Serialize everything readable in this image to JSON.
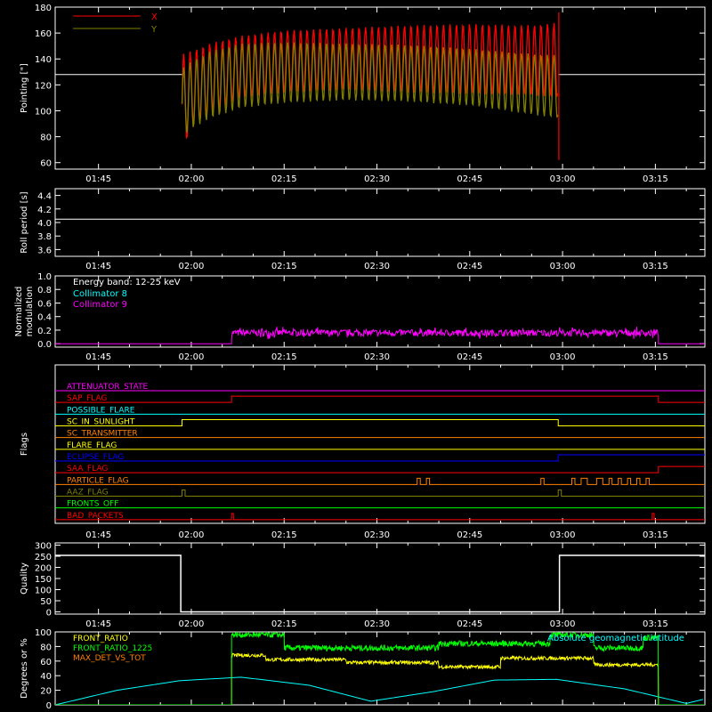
{
  "time_axis": {
    "tick_labels": [
      "01:45",
      "02:00",
      "02:15",
      "02:30",
      "02:45",
      "03:00",
      "03:15"
    ],
    "tick_minutes": [
      105,
      120,
      135,
      150,
      165,
      180,
      195
    ],
    "range_minutes": [
      98,
      203
    ]
  },
  "chart_data": [
    {
      "id": "pointing",
      "type": "line",
      "ylabel": "Pointing [\"]",
      "ylim": [
        55,
        180
      ],
      "yticks": [
        60,
        80,
        100,
        120,
        140,
        160,
        180
      ],
      "legend": [
        {
          "name": "X",
          "color": "#ff0000"
        },
        {
          "name": "Y",
          "color": "#808000"
        }
      ],
      "series": [
        {
          "name": "X",
          "color": "#ff0000",
          "start": 118.5,
          "end": 179.3,
          "x": [
            118.5,
            120,
            123,
            128,
            135,
            145,
            155,
            165,
            175,
            179.3
          ],
          "upper": [
            144,
            146,
            152,
            158,
            162,
            164,
            166,
            167,
            166,
            168
          ],
          "lower": [
            66,
            88,
            98,
            110,
            114,
            116,
            114,
            113,
            112,
            110
          ]
        },
        {
          "name": "Y",
          "color": "#808000",
          "start": 118.5,
          "end": 179.3,
          "x": [
            118.5,
            120,
            123,
            128,
            135,
            145,
            155,
            165,
            175,
            179.3
          ],
          "upper": [
            133,
            138,
            146,
            152,
            153,
            152,
            151,
            148,
            144,
            143
          ],
          "lower": [
            78,
            86,
            94,
            102,
            106,
            108,
            107,
            104,
            97,
            94
          ]
        }
      ],
      "baseline": {
        "value": 128,
        "color": "#ffffff"
      },
      "spike": {
        "x": 179.4,
        "top": 176,
        "bottom": 62
      }
    },
    {
      "id": "roll_period",
      "type": "line",
      "ylabel": "Roll period [s]",
      "ylim": [
        3.5,
        4.5
      ],
      "yticks": [
        3.6,
        3.8,
        4.0,
        4.2,
        4.4
      ],
      "series": [
        {
          "name": "",
          "color": "#ffffff",
          "value": 4.05
        }
      ]
    },
    {
      "id": "modulation",
      "type": "line",
      "ylabel": "Normalized modulation",
      "ylim": [
        -0.05,
        1.0
      ],
      "yticks": [
        0.0,
        0.2,
        0.4,
        0.6,
        0.8,
        1.0
      ],
      "annotation": "Energy band: 12-25 keV",
      "legend": [
        {
          "name": "Collimator 8",
          "color": "#00ffff"
        },
        {
          "name": "Collimator 9",
          "color": "#ff00ff"
        }
      ],
      "series": [
        {
          "name": "Collimator 9",
          "color": "#ff00ff",
          "active": [
            126.5,
            195.5
          ],
          "mean": 0.16,
          "noise": 0.05,
          "off": 0.0
        }
      ]
    },
    {
      "id": "flags",
      "type": "line",
      "ylabel": "Flags",
      "flags": [
        {
          "name": "ATTENUATOR_STATE",
          "color": "#ff00ff",
          "transitions": []
        },
        {
          "name": "SAP_FLAG",
          "color": "#ff0000",
          "transitions": [
            [
              126.5,
              1
            ],
            [
              195.5,
              0
            ]
          ]
        },
        {
          "name": "POSSIBLE_FLARE",
          "color": "#00ffff",
          "transitions": []
        },
        {
          "name": "SC_IN_SUNLIGHT",
          "color": "#ffff00",
          "transitions": [
            [
              118.5,
              1
            ],
            [
              179.3,
              0
            ]
          ]
        },
        {
          "name": "SC_TRANSMITTER",
          "color": "#ff8000",
          "transitions": []
        },
        {
          "name": "FLARE_FLAG",
          "color": "#ffff00",
          "transitions": []
        },
        {
          "name": "ECLIPSE_FLAG",
          "color": "#0000ff",
          "transitions": [
            [
              118.5,
              0
            ],
            [
              179.3,
              1
            ]
          ]
        },
        {
          "name": "SAA_FLAG",
          "color": "#ff0000",
          "transitions": [
            [
              123.5,
              0
            ],
            [
              195.5,
              1
            ]
          ]
        },
        {
          "name": "PARTICLE_FLAG",
          "color": "#ff8000",
          "transitions": [
            [
              156.5,
              1
            ],
            [
              157,
              0
            ],
            [
              158,
              1
            ],
            [
              158.5,
              0
            ],
            [
              176.5,
              1
            ],
            [
              177,
              0
            ],
            [
              181.5,
              1
            ],
            [
              182,
              0
            ],
            [
              183,
              1
            ],
            [
              184,
              0
            ],
            [
              185.5,
              1
            ],
            [
              186.5,
              0
            ],
            [
              187.5,
              1
            ],
            [
              188,
              0
            ],
            [
              189,
              1
            ],
            [
              189.5,
              0
            ],
            [
              190.5,
              1
            ],
            [
              191,
              0
            ],
            [
              192,
              1
            ],
            [
              192.5,
              0
            ],
            [
              193.5,
              1
            ],
            [
              194,
              0
            ]
          ]
        },
        {
          "name": "AAZ_FLAG",
          "color": "#808000",
          "transitions": [
            [
              118.5,
              1
            ],
            [
              119,
              0
            ],
            [
              179.3,
              1
            ],
            [
              179.8,
              0
            ]
          ]
        },
        {
          "name": "FRONTS_OFF",
          "color": "#00ff00",
          "transitions": []
        },
        {
          "name": "BAD_PACKETS",
          "color": "#ff0000",
          "transitions": [
            [
              126.5,
              1
            ],
            [
              126.8,
              0
            ],
            [
              194.5,
              1
            ],
            [
              194.8,
              0
            ]
          ]
        }
      ]
    },
    {
      "id": "quality",
      "type": "line",
      "ylabel": "Quality",
      "ylim": [
        -10,
        310
      ],
      "yticks": [
        0,
        50,
        100,
        150,
        200,
        250,
        300
      ],
      "series": [
        {
          "name": "",
          "color": "#ffffff",
          "segments": [
            [
              98,
              118.3,
              254
            ],
            [
              118.3,
              179.5,
              0
            ],
            [
              179.5,
              203,
              254
            ]
          ]
        }
      ]
    },
    {
      "id": "ratios",
      "type": "line",
      "ylabel": "Degrees or %",
      "ylim": [
        0,
        100
      ],
      "yticks": [
        0,
        20,
        40,
        60,
        80,
        100
      ],
      "legend": [
        {
          "name": "FRONT_RATIO",
          "color": "#ffff00"
        },
        {
          "name": "FRONT_RATIO_1225",
          "color": "#00ff00"
        },
        {
          "name": "MAX_DET_VS_TOT",
          "color": "#ff8000"
        }
      ],
      "annotation": "Absolute geomagnetic latitude",
      "annotation_color": "#00ffff",
      "series": [
        {
          "name": "FRONT_RATIO",
          "color": "#ffff00",
          "active": [
            126.5,
            195.5
          ],
          "levels": [
            [
              126.5,
              132,
              68
            ],
            [
              132,
              145,
              62
            ],
            [
              145,
              160,
              58
            ],
            [
              160,
              170,
              52
            ],
            [
              170,
              185,
              64
            ],
            [
              185,
              195.5,
              55
            ]
          ]
        },
        {
          "name": "FRONT_RATIO_1225",
          "color": "#00ff00",
          "active": [
            126.5,
            195.5
          ],
          "levels": [
            [
              126.5,
              135,
              96
            ],
            [
              135,
              160,
              78
            ],
            [
              160,
              178,
              84
            ],
            [
              178,
              185,
              96
            ],
            [
              185,
              193,
              78
            ],
            [
              193,
              195.5,
              92
            ]
          ]
        },
        {
          "name": "Absolute geomagnetic latitude",
          "color": "#00ffff",
          "x": [
            98,
            108,
            118,
            128,
            139,
            149,
            159,
            169,
            179,
            190,
            200,
            203
          ],
          "y": [
            0,
            20,
            33,
            38,
            27,
            5,
            18,
            34,
            35,
            22,
            2,
            8
          ]
        }
      ]
    }
  ]
}
